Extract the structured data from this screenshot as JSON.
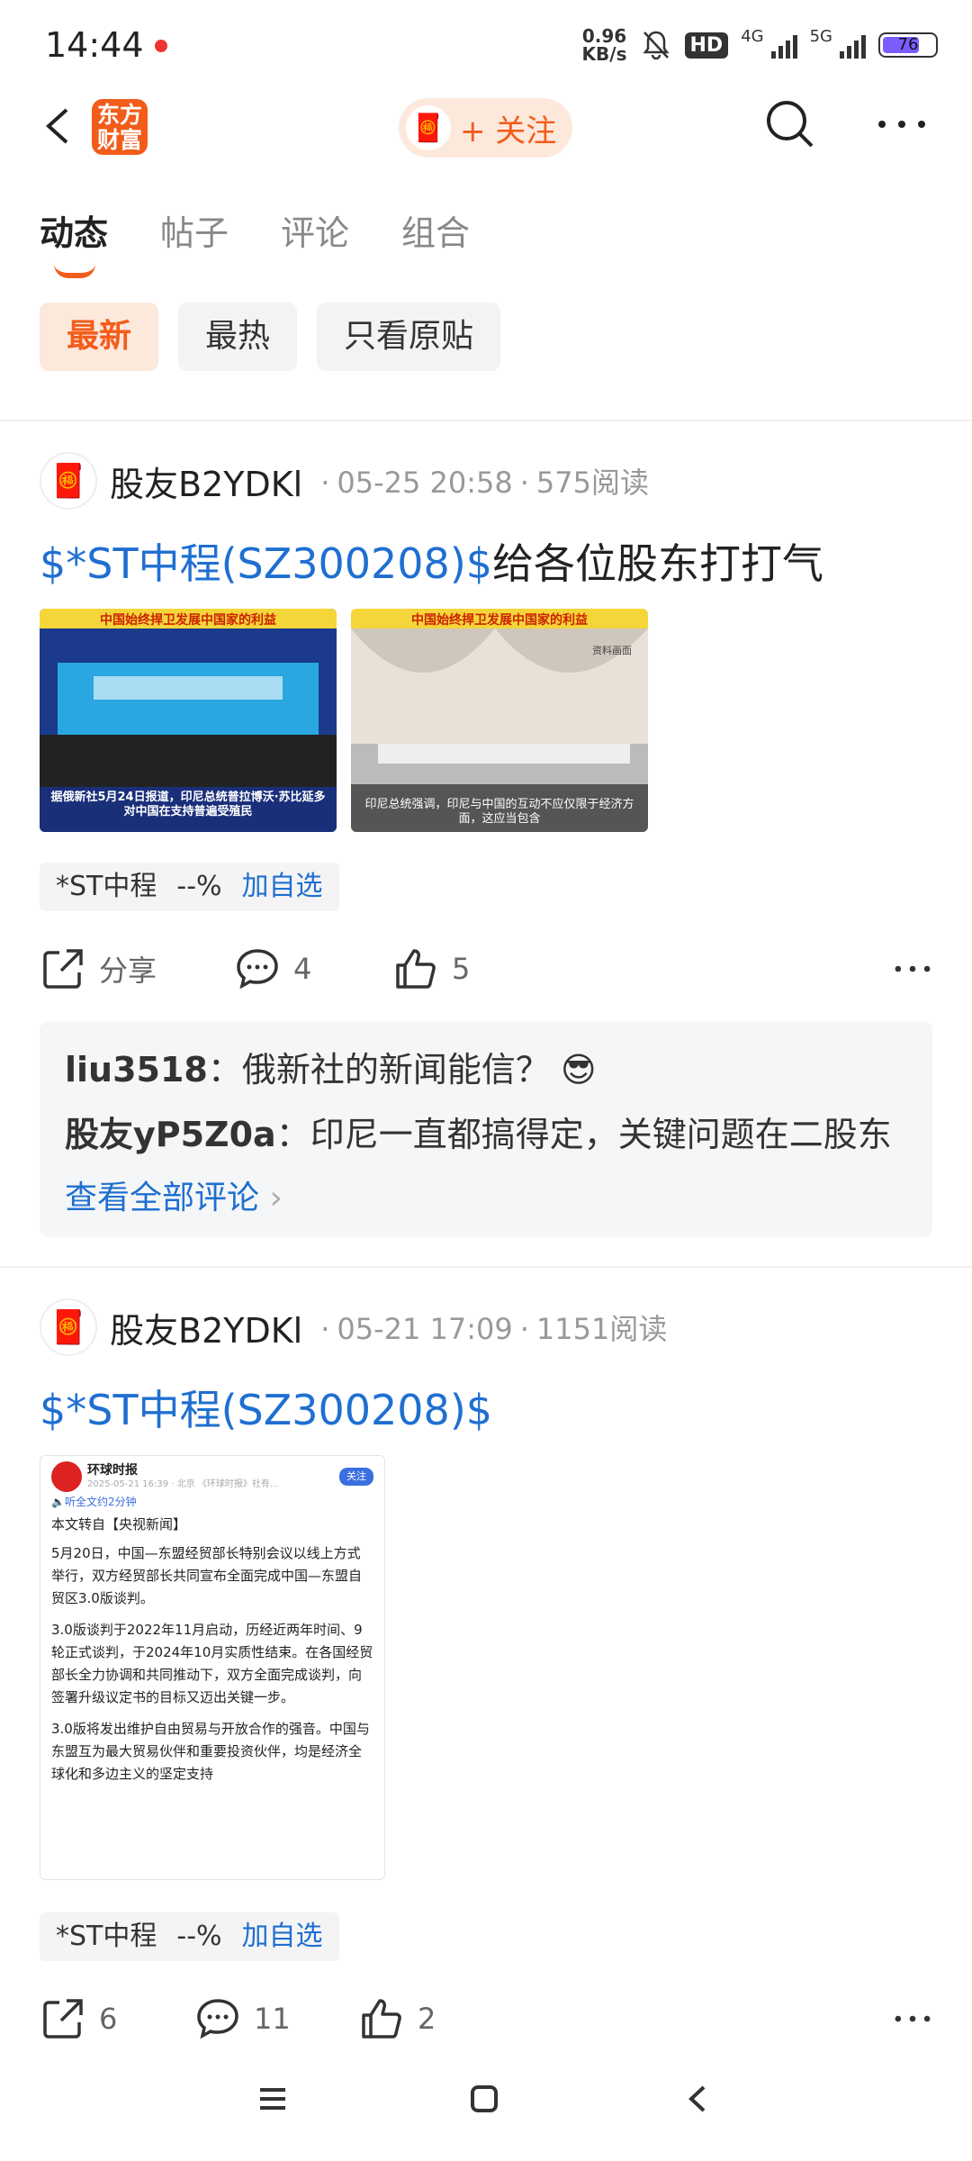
{
  "status_bar": {
    "time": "14:44",
    "speed_value": "0.96",
    "speed_unit": "KB/s",
    "hd_label": "HD",
    "network_1": "4G",
    "network_2": "5G",
    "battery": "76"
  },
  "header": {
    "logo_line1": "东方",
    "logo_line2": "财富",
    "follow_label": "+ 关注",
    "icons": [
      "back-icon",
      "search-icon",
      "more-icon"
    ]
  },
  "tabs": [
    "动态",
    "帖子",
    "评论",
    "组合"
  ],
  "filters": [
    "最新",
    "最热",
    "只看原贴"
  ],
  "posts": [
    {
      "author": "股友B2YDKl",
      "date": "05-25 20:58",
      "reads": "575阅读",
      "tag": "$*ST中程(SZ300208)$",
      "text": "给各位股东打打气",
      "image1_title": "中国始终捍卫发展中国家的利益",
      "image1_caption": "据俄新社5月24日报道，印尼总统普拉博沃·苏比延多对中国在支持普遍受殖民",
      "image2_title": "中国始终捍卫发展中国家的利益",
      "image2_badge": "资料画面",
      "image2_caption": "印尼总统强调，印尼与中国的互动不应仅限于经济方面，这应当包含",
      "stock_name": "*ST中程",
      "stock_change": "--%",
      "add_label": "加自选",
      "share_label": "分享",
      "comment_count": "4",
      "like_count": "5",
      "comments": [
        {
          "user": "liu3518",
          "text": "俄新社的新闻能信？"
        },
        {
          "user": "股友yP5Z0a",
          "text": "印尼一直都搞得定，关键问题在二股东"
        }
      ],
      "view_all": "查看全部评论"
    },
    {
      "author": "股友B2YDKl",
      "date": "05-21 17:09",
      "reads": "1151阅读",
      "tag": "$*ST中程(SZ300208)$",
      "article": {
        "source": "环球时报",
        "follow": "关注",
        "meta": "2025-05-21 16:39 · 北京 《环球时报》社有...",
        "listen": "听全文约2分钟",
        "intro": "本文转自【央视新闻】",
        "p1": "5月20日，中国—东盟经贸部长特别会议以线上方式举行，双方经贸部长共同宣布全面完成中国—东盟自贸区3.0版谈判。",
        "p2": "3.0版谈判于2022年11月启动，历经近两年时间、9轮正式谈判，于2024年10月实质性结束。在各国经贸部长全力协调和共同推动下，双方全面完成谈判，向签署升级议定书的目标又迈出关键一步。",
        "p3": "3.0版将发出维护自由贸易与开放合作的强音。中国与东盟互为最大贸易伙伴和重要投资伙伴，均是经济全球化和多边主义的坚定支持"
      },
      "stock_name": "*ST中程",
      "stock_change": "--%",
      "add_label": "加自选",
      "share_count": "6",
      "comment_count": "11",
      "like_count": "2"
    }
  ]
}
